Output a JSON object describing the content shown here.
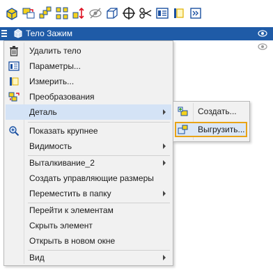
{
  "colors": {
    "selection": "#1f5ba7",
    "menu_bg": "#f1f1f1",
    "hover": "#d4e3f6",
    "highlight_outline": "#e8a317"
  },
  "toolbar": {
    "icons": [
      "solid-body-icon",
      "boolean-icon",
      "pattern-icon",
      "mirror-pattern-icon",
      "scale-icon",
      "hide-icon",
      "box-icon",
      "crosshair-icon",
      "scissors-icon",
      "parameters-icon",
      "measure-icon",
      "more-icon"
    ]
  },
  "tree": {
    "selected_item": "Тело Зажим"
  },
  "context_menu": {
    "items": [
      {
        "label": "Удалить тело",
        "icon": "trash-icon"
      },
      {
        "label": "Параметры...",
        "icon": "parameters-icon"
      },
      {
        "label": "Измерить...",
        "icon": "measure-icon"
      },
      {
        "label": "Преобразования",
        "icon": "transform-icon"
      },
      {
        "label": "Деталь",
        "icon": "",
        "submenu": true
      },
      {
        "label": "Показать крупнее",
        "icon": "zoom-icon"
      },
      {
        "label": "Видимость",
        "icon": "",
        "submenu": true
      },
      {
        "label": "Выталкивание_2",
        "icon": "",
        "submenu": true
      },
      {
        "label": "Создать управляющие размеры",
        "icon": ""
      },
      {
        "label": "Переместить в папку",
        "icon": "",
        "submenu": true
      },
      {
        "label": "Перейти к элементам",
        "icon": ""
      },
      {
        "label": "Скрыть элемент",
        "icon": ""
      },
      {
        "label": "Открыть в новом окне",
        "icon": ""
      },
      {
        "label": "Вид",
        "icon": "",
        "submenu": true
      }
    ]
  },
  "submenu": {
    "items": [
      {
        "label": "Создать...",
        "icon": "create-part-icon"
      },
      {
        "label": "Выгрузить...",
        "icon": "export-part-icon"
      }
    ]
  }
}
